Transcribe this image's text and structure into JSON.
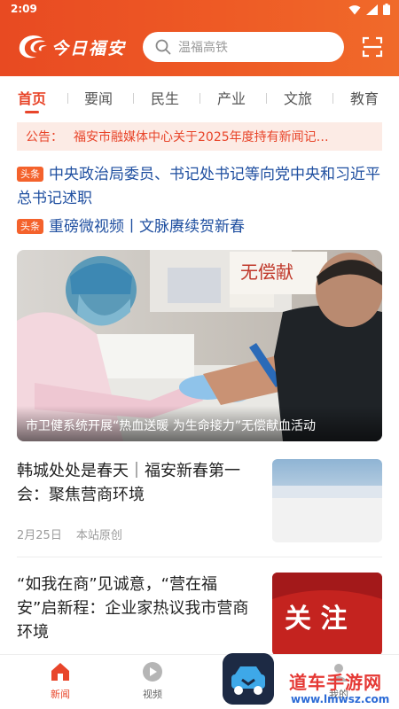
{
  "status_bar": {
    "time": "2:09"
  },
  "header": {
    "logo_text": "今日福安",
    "search_placeholder": "温福高铁"
  },
  "tabs": [
    {
      "label": "首页",
      "active": true
    },
    {
      "label": "要闻"
    },
    {
      "label": "民生"
    },
    {
      "label": "产业"
    },
    {
      "label": "文旅"
    },
    {
      "label": "教育"
    }
  ],
  "notice": {
    "label": "公告：",
    "text": "福安市融媒体中心关于2025年度持有新闻记…"
  },
  "headlines": [
    {
      "badge": "头条",
      "text": "中央政治局委员、书记处书记等向党中央和习近平总书记述职"
    },
    {
      "badge": "头条",
      "text": "重磅微视频丨文脉赓续贺新春"
    }
  ],
  "hero": {
    "caption": "市卫健系统开展“热血送暖 为生命接力”无偿献血活动",
    "sign_text": "无偿献"
  },
  "news": [
    {
      "title": "韩城处处是春天｜福安新春第一会：聚焦营商环境",
      "date": "2月25日",
      "source": "本站原创"
    },
    {
      "title": "“如我在商”见诚意，“营在福安”启新程：企业家热议我市营商环境",
      "thumb_text": "关 注"
    }
  ],
  "bottom_nav": [
    {
      "label": "新闻",
      "icon": "home-icon",
      "active": true
    },
    {
      "label": "视频",
      "icon": "play-icon"
    },
    {
      "label": "我的",
      "icon": "user-icon"
    }
  ],
  "watermark": {
    "title": "道车手游网",
    "url": "www.lmwsz.com"
  },
  "colors": {
    "accent": "#e8452a",
    "header_start": "#e84a22",
    "header_end": "#f06a2a",
    "link_blue": "#1f4fa0"
  }
}
